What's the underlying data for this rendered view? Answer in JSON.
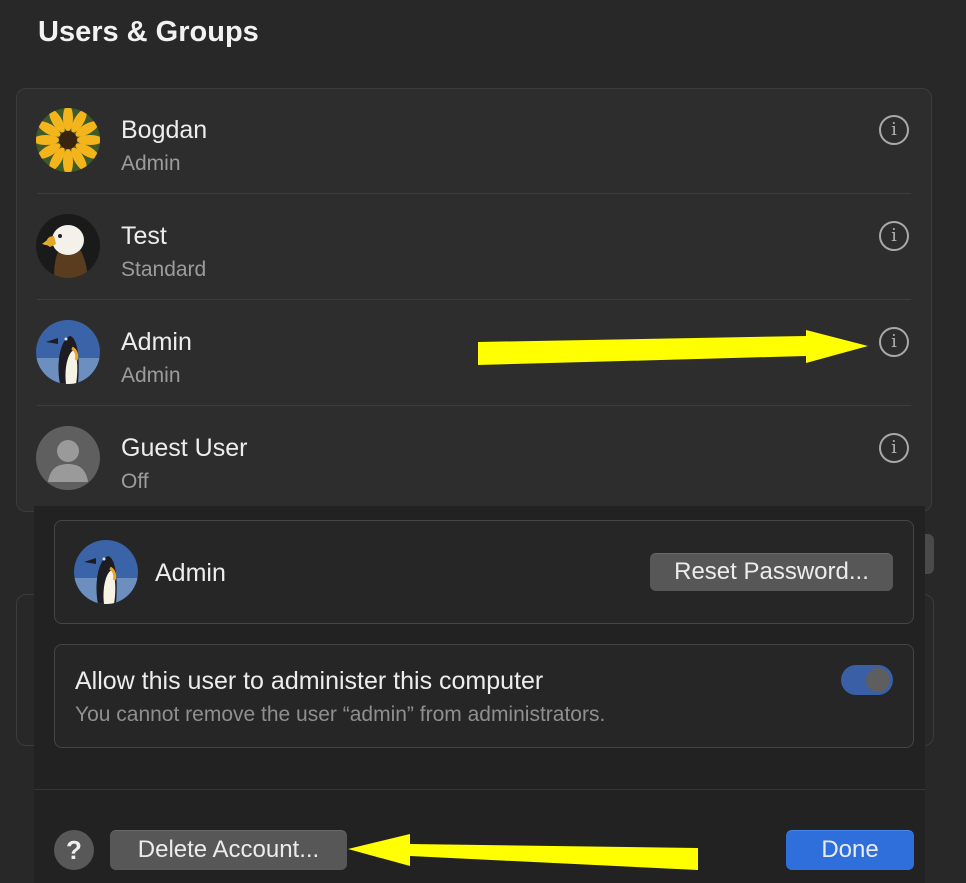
{
  "window": {
    "title": "Users & Groups"
  },
  "users": [
    {
      "name": "Bogdan",
      "role": "Admin",
      "avatar": "sunflower-avatar"
    },
    {
      "name": "Test",
      "role": "Standard",
      "avatar": "eagle-avatar"
    },
    {
      "name": "Admin",
      "role": "Admin",
      "avatar": "penguin-avatar"
    },
    {
      "name": "Guest User",
      "role": "Off",
      "avatar": "generic-person-avatar"
    }
  ],
  "info_icon_glyph": "i",
  "sheet": {
    "user_name": "Admin",
    "reset_password_label": "Reset Password...",
    "admin_toggle": {
      "label": "Allow this user to administer this computer",
      "description": "You cannot remove the user “admin” from administrators.",
      "on": true
    },
    "help_label": "?",
    "delete_account_label": "Delete Account...",
    "done_label": "Done"
  },
  "colors": {
    "accent": "#2f6fdc",
    "toggle_on": "#3a5fa6",
    "annotation_arrow": "#ffff00"
  }
}
